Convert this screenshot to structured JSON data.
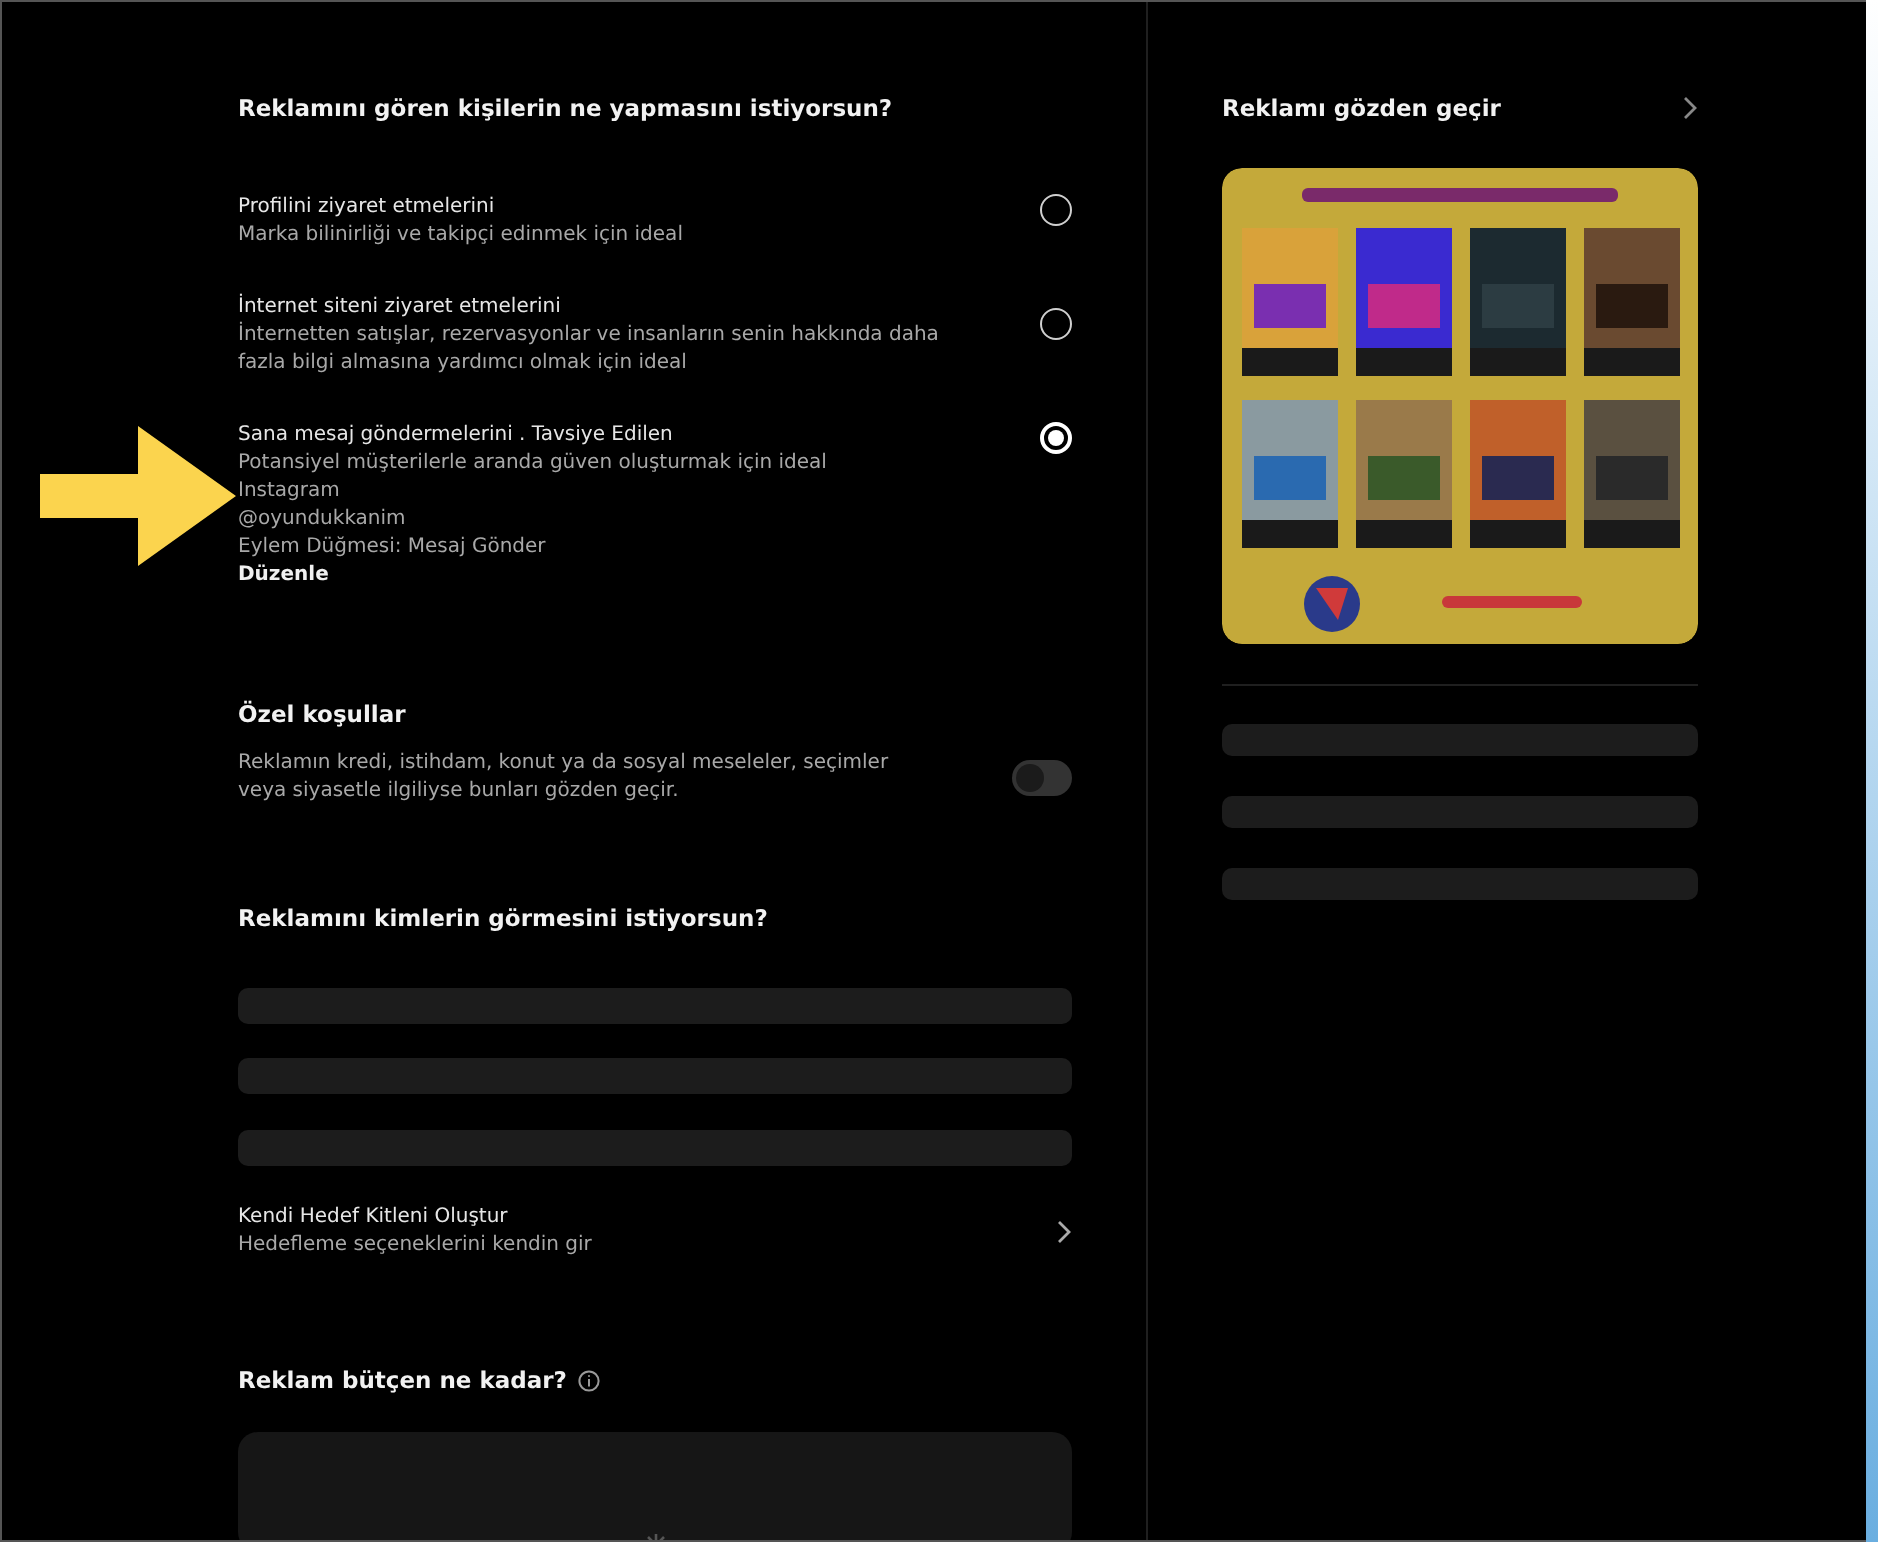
{
  "objective": {
    "title": "Reklamını gören kişilerin ne yapmasını istiyorsun?",
    "options": [
      {
        "label": "Profilini ziyaret etmelerini",
        "description": "Marka bilinirliği ve takipçi edinmek için ideal",
        "selected": false
      },
      {
        "label": "İnternet siteni ziyaret etmelerini",
        "description": "İnternetten satışlar, rezervasyonlar ve insanların senin hakkında daha fazla bilgi almasına yardımcı olmak için ideal",
        "selected": false
      },
      {
        "label": "Sana mesaj göndermelerini . Tavsiye Edilen",
        "description": "Potansiyel müşterilerle aranda güven oluşturmak için ideal",
        "selected": true,
        "details": [
          "Instagram",
          "@oyundukkanim",
          "Eylem Düğmesi: Mesaj Gönder"
        ],
        "edit_link": "Düzenle"
      }
    ]
  },
  "special_conditions": {
    "title": "Özel koşullar",
    "description": "Reklamın kredi, istihdam, konut ya da sosyal meseleler, seçimler veya siyasetle ilgiliyse bunları gözden geçir.",
    "on": false
  },
  "audience": {
    "title": "Reklamını kimlerin görmesini istiyorsun?",
    "custom": {
      "title": "Kendi Hedef Kitleni Oluştur",
      "subtitle": "Hedefleme seçeneklerini kendin gir"
    }
  },
  "budget": {
    "title": "Reklam bütçen ne kadar?"
  },
  "review": {
    "title": "Reklamı gözden geçir"
  }
}
